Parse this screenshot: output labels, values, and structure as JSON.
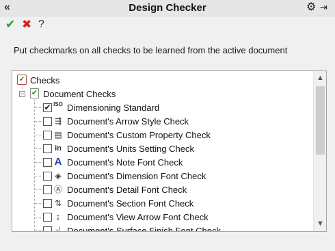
{
  "window": {
    "title": "Design Checker"
  },
  "toolbar": {
    "collapse_glyph": "«",
    "options_glyph": "⚙",
    "pin_glyph": "⇥"
  },
  "actions": {
    "ok_glyph": "✔",
    "cancel_glyph": "✖",
    "help_glyph": "?"
  },
  "instruction": "Put checkmarks on all checks to be learned from the active document",
  "tree": {
    "root_label": "Checks",
    "group_label": "Document Checks",
    "items": [
      {
        "label": "Dimensioning Standard",
        "checked": true,
        "icon": "iso-din-icon",
        "glyph": "ISO"
      },
      {
        "label": "Document's Arrow Style Check",
        "checked": false,
        "icon": "arrow-style-icon",
        "glyph": "⇶"
      },
      {
        "label": "Document's Custom Property Check",
        "checked": false,
        "icon": "custom-property-icon",
        "glyph": "▤"
      },
      {
        "label": "Document's Units Setting Check",
        "checked": false,
        "icon": "units-icon",
        "glyph": "in"
      },
      {
        "label": "Document's Note Font Check",
        "checked": false,
        "icon": "note-font-icon",
        "glyph": "A"
      },
      {
        "label": "Document's Dimension Font Check",
        "checked": false,
        "icon": "dimension-font-icon",
        "glyph": "◈"
      },
      {
        "label": "Document's Detail Font Check",
        "checked": false,
        "icon": "detail-font-icon",
        "glyph": "Ⓐ"
      },
      {
        "label": "Document's Section Font Check",
        "checked": false,
        "icon": "section-font-icon",
        "glyph": "⇅"
      },
      {
        "label": "Document's View Arrow Font Check",
        "checked": false,
        "icon": "view-arrow-font-icon",
        "glyph": "↨"
      },
      {
        "label": "Document's Surface Finish Font Check",
        "checked": false,
        "icon": "surface-finish-font-icon",
        "glyph": "√"
      }
    ]
  },
  "scrollbar": {
    "up_glyph": "▲",
    "down_glyph": "▼",
    "scroll_fraction": 0.0
  },
  "colors": {
    "ok": "#1c9c2a",
    "cancel": "#d32020",
    "title_bar": "#e6e6e6"
  }
}
